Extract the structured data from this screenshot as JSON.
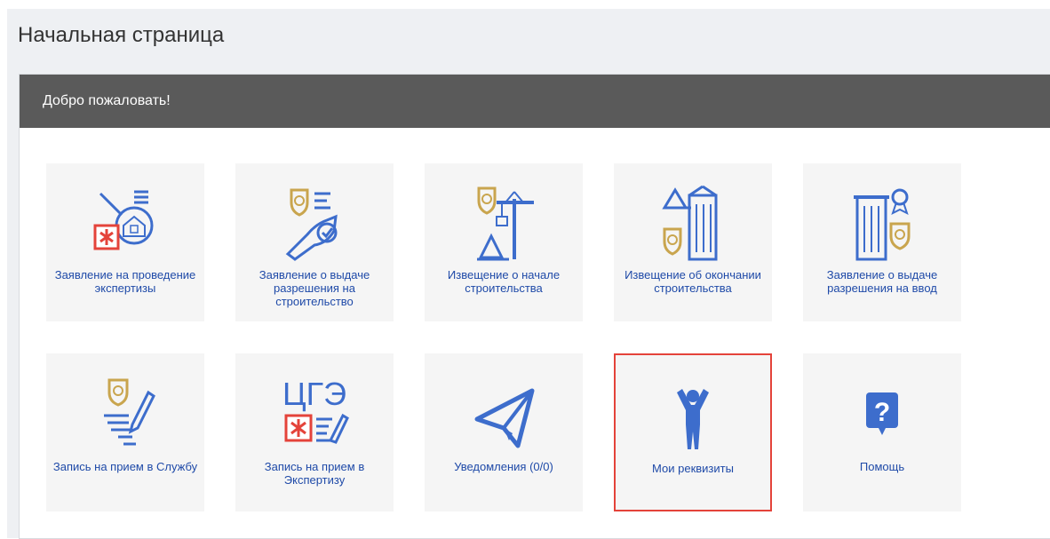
{
  "page": {
    "title": "Начальная страница"
  },
  "panel": {
    "header": "Добро пожаловать!"
  },
  "tiles": [
    {
      "label": "Заявление на проведение экспертизы",
      "icon": "expertise-application-icon"
    },
    {
      "label": "Заявление о выдаче разрешения на строительство",
      "icon": "construction-permit-icon"
    },
    {
      "label": "Извещение о начале строительства",
      "icon": "construction-start-notice-icon"
    },
    {
      "label": "Извещение об окончании строительства",
      "icon": "construction-end-notice-icon"
    },
    {
      "label": "Заявление о выдаче разрешения на ввод",
      "icon": "commissioning-permit-icon"
    },
    {
      "label": "Запись на прием в Службу",
      "icon": "service-appointment-icon"
    },
    {
      "label": "Запись на прием в Экспертизу",
      "icon": "expertise-appointment-icon",
      "icon_text": "ЦГЭ"
    },
    {
      "label": "Уведомления (0/0)",
      "icon": "paper-plane-icon"
    },
    {
      "label": "Мои реквизиты",
      "icon": "person-icon",
      "selected": true
    },
    {
      "label": "Помощь",
      "icon": "help-icon",
      "icon_text": "?"
    }
  ],
  "colors": {
    "icon_blue": "#3d6dcc",
    "icon_gold": "#c9a54e",
    "icon_red": "#e4433a",
    "selection": "#e4433a",
    "header_bg": "#5a5a5a"
  }
}
